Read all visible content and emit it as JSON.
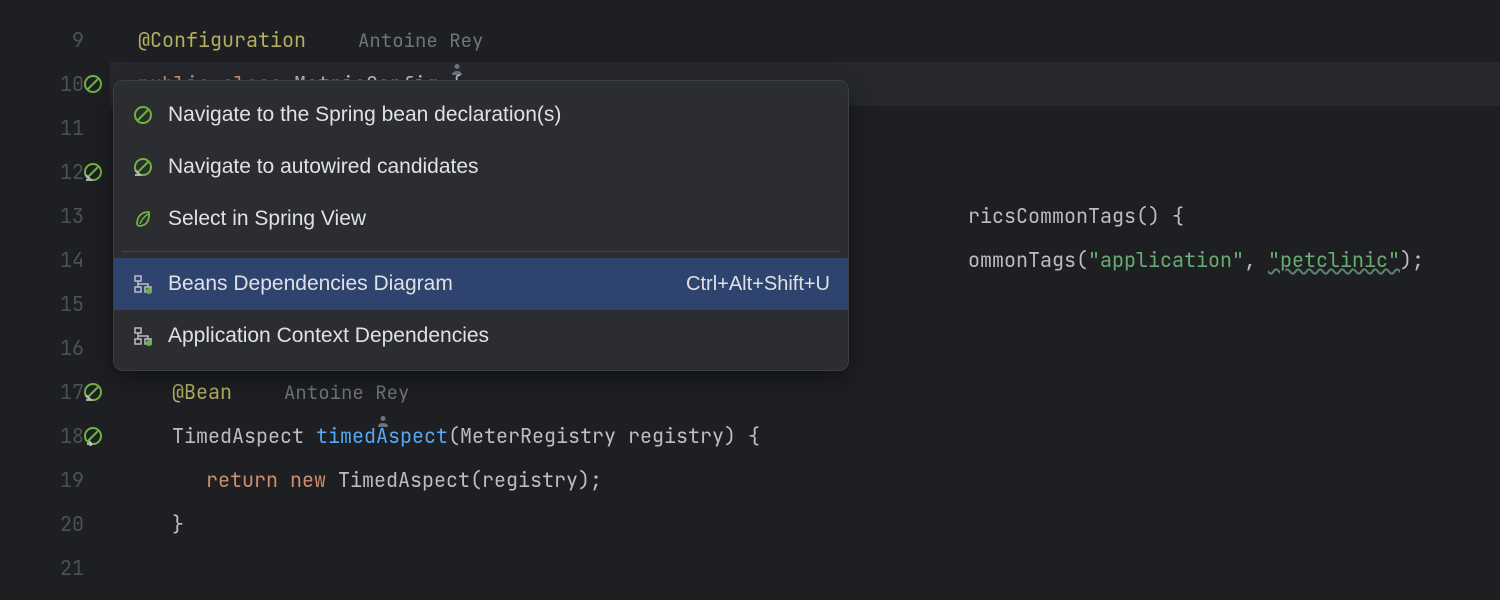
{
  "lines": [
    {
      "num": "9"
    },
    {
      "num": "10"
    },
    {
      "num": "11"
    },
    {
      "num": "12"
    },
    {
      "num": "13"
    },
    {
      "num": "14"
    },
    {
      "num": "15"
    },
    {
      "num": "16"
    },
    {
      "num": "17"
    },
    {
      "num": "18"
    },
    {
      "num": "19"
    },
    {
      "num": "20"
    },
    {
      "num": "21"
    }
  ],
  "code": {
    "l9_annotation": "@Configuration",
    "l9_author": "Antoine Rey",
    "l10_kw1": "public",
    "l10_kw2": "class",
    "l10_type": "MetricConfig",
    "l10_brace": " {",
    "l13_partial": "ricsCommonTags() {",
    "l14_partial1": "ommonTags(",
    "l14_str1": "\"application\"",
    "l14_comma": ", ",
    "l14_str2": "\"petclinic\"",
    "l14_end": ");",
    "l17_annotation": "@Bean",
    "l17_author": "Antoine Rey",
    "l18_type": "TimedAspect",
    "l18_method": "timedAspect",
    "l18_paren1": "(",
    "l18_ptype": "MeterRegistry",
    "l18_pname": " registry",
    "l18_paren2": ") {",
    "l19_kw1": "return",
    "l19_kw2": "new",
    "l19_type": "TimedAspect",
    "l19_paren": "(registry);",
    "l20_brace": "}"
  },
  "popup": {
    "items": [
      {
        "label": "Navigate to the Spring bean declaration(s)",
        "shortcut": ""
      },
      {
        "label": "Navigate to autowired candidates",
        "shortcut": ""
      },
      {
        "label": "Select in Spring View",
        "shortcut": ""
      },
      {
        "label": "Beans Dependencies Diagram",
        "shortcut": "Ctrl+Alt+Shift+U"
      },
      {
        "label": "Application Context Dependencies",
        "shortcut": ""
      }
    ]
  }
}
